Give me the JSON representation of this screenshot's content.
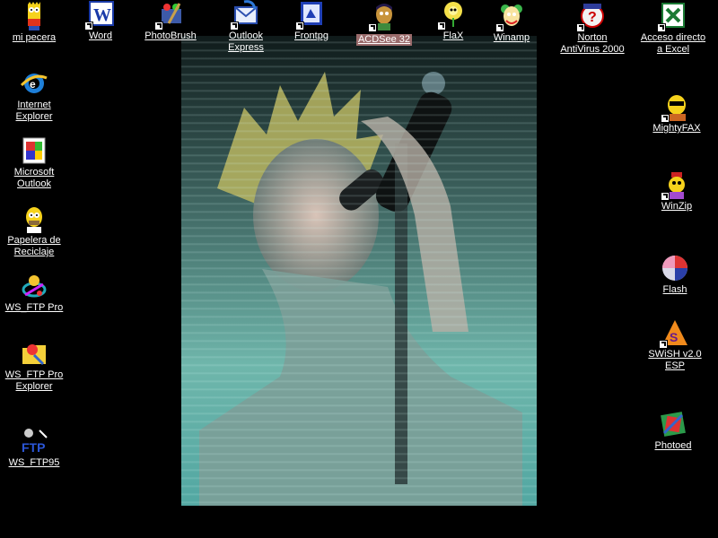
{
  "desktop": {
    "background": "#000000",
    "wallpaper_description_colors": [
      "#1a2a2a",
      "#6fb0a5"
    ],
    "icons": [
      {
        "name": "mi pecera",
        "icon": "simpsons-bart-icon",
        "shortcut": false
      },
      {
        "name": "Word",
        "icon": "word-icon",
        "shortcut": true
      },
      {
        "name": "PhotoBrush",
        "icon": "photobrush-icon",
        "shortcut": true
      },
      {
        "name": "Outlook Express",
        "icon": "outlook-express-icon",
        "shortcut": true
      },
      {
        "name": "Frontpg",
        "icon": "frontpage-icon",
        "shortcut": true
      },
      {
        "name": "ACDSee 32",
        "icon": "simpsons-apu-icon",
        "shortcut": true,
        "selected": true
      },
      {
        "name": "FlaX",
        "icon": "simpsons-flower-icon",
        "shortcut": true
      },
      {
        "name": "Winamp",
        "icon": "simpsons-krusty-icon",
        "shortcut": true
      },
      {
        "name": "Norton AntiVirus 2000",
        "icon": "norton-antivirus-icon",
        "shortcut": true
      },
      {
        "name": "Acceso directo a Excel",
        "icon": "excel-icon",
        "shortcut": true
      },
      {
        "name": "Internet Explorer",
        "icon": "internet-explorer-icon",
        "shortcut": false
      },
      {
        "name": "Microsoft Outlook",
        "icon": "microsoft-outlook-icon",
        "shortcut": false
      },
      {
        "name": "Papelera de Reciclaje",
        "icon": "simpsons-homer-icon",
        "shortcut": false
      },
      {
        "name": "WS_FTP Pro",
        "icon": "ws-ftp-pro-icon",
        "shortcut": false
      },
      {
        "name": "WS_FTP Pro Explorer",
        "icon": "ws-ftp-pro-explorer-icon",
        "shortcut": false
      },
      {
        "name": "WS_FTP95",
        "icon": "ws-ftp95-icon",
        "shortcut": false
      },
      {
        "name": "MightyFAX",
        "icon": "mightyfax-icon",
        "shortcut": true
      },
      {
        "name": "WinZip",
        "icon": "winzip-icon",
        "shortcut": true
      },
      {
        "name": "Flash",
        "icon": "flash-icon",
        "shortcut": false
      },
      {
        "name": "SWiSH v2.0 ESP",
        "icon": "swish-icon",
        "shortcut": true
      },
      {
        "name": "Photoed",
        "icon": "photoed-icon",
        "shortcut": false
      }
    ]
  }
}
